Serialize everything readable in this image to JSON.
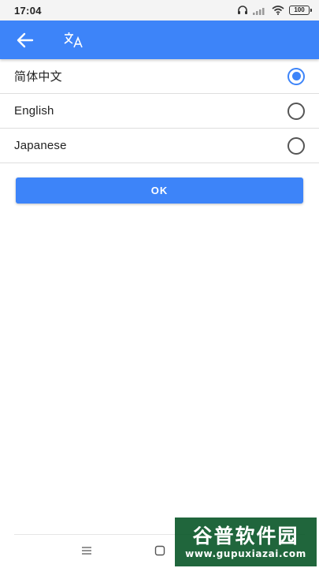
{
  "status_bar": {
    "time": "17:04",
    "battery": "100"
  },
  "toolbar": {
    "back_icon": "arrow-left-icon",
    "title_icon": "translate-icon",
    "color": "#3d84f9"
  },
  "languages": [
    {
      "label": "简体中文",
      "selected": true
    },
    {
      "label": "English",
      "selected": false
    },
    {
      "label": "Japanese",
      "selected": false
    }
  ],
  "ok_button": {
    "label": "OK"
  },
  "nav_bar": {
    "menu_icon": "menu-icon",
    "home_icon": "home-square-icon"
  },
  "watermark": {
    "title": "谷普软件园",
    "url": "www.gupuxiazai.com"
  }
}
